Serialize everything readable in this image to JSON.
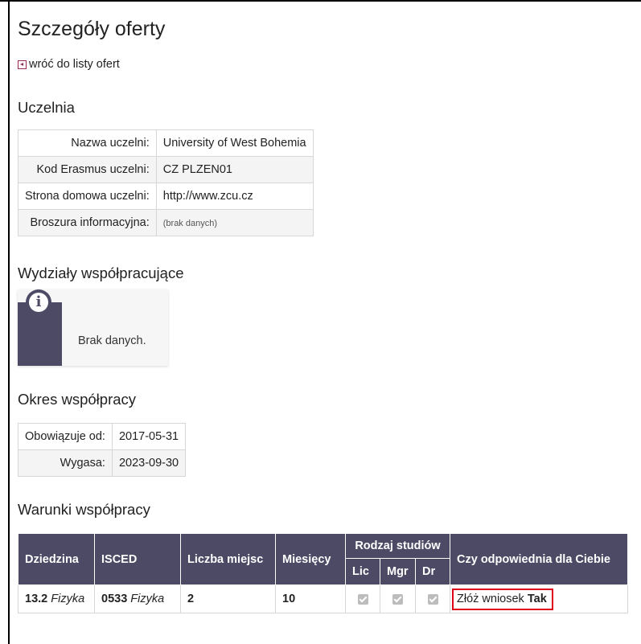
{
  "page": {
    "title": "Szczegóły oferty",
    "back_link": "wróć do listy ofert"
  },
  "uczelnia": {
    "heading": "Uczelnia",
    "rows": [
      {
        "label": "Nazwa uczelni:",
        "value": "University of West Bohemia"
      },
      {
        "label": "Kod Erasmus uczelni:",
        "value": "CZ PLZEN01"
      },
      {
        "label": "Strona domowa uczelni:",
        "value": "http://www.zcu.cz"
      },
      {
        "label": "Broszura informacyjna:",
        "value": "(brak danych)"
      }
    ]
  },
  "wydzialy": {
    "heading": "Wydziały współpracujące",
    "notice": "Brak danych."
  },
  "okres": {
    "heading": "Okres współpracy",
    "rows": [
      {
        "label": "Obowiązuje od:",
        "value": "2017-05-31"
      },
      {
        "label": "Wygasa:",
        "value": "2023-09-30"
      }
    ]
  },
  "warunki": {
    "heading": "Warunki współpracy",
    "headers": {
      "dziedzina": "Dziedzina",
      "isced": "ISCED",
      "liczba_miejsc": "Liczba miejsc",
      "miesiecy": "Miesięcy",
      "rodzaj": "Rodzaj studiów",
      "lic": "Lic",
      "mgr": "Mgr",
      "dr": "Dr",
      "odpowiednia": "Czy odpowiednia dla Ciebie"
    },
    "rows": [
      {
        "dziedzina_code": "13.2",
        "dziedzina_name": "Fizyka",
        "isced_code": "0533",
        "isced_name": "Fizyka",
        "liczba_miejsc": "2",
        "miesiecy": "10",
        "lic": true,
        "mgr": true,
        "dr": true,
        "apply_label": "Złóż wniosek",
        "suitable": "Tak"
      }
    ]
  },
  "colors": {
    "header_bg": "#4d4a66",
    "highlight_border": "#e0001a",
    "back_icon": "#9a2a56"
  }
}
